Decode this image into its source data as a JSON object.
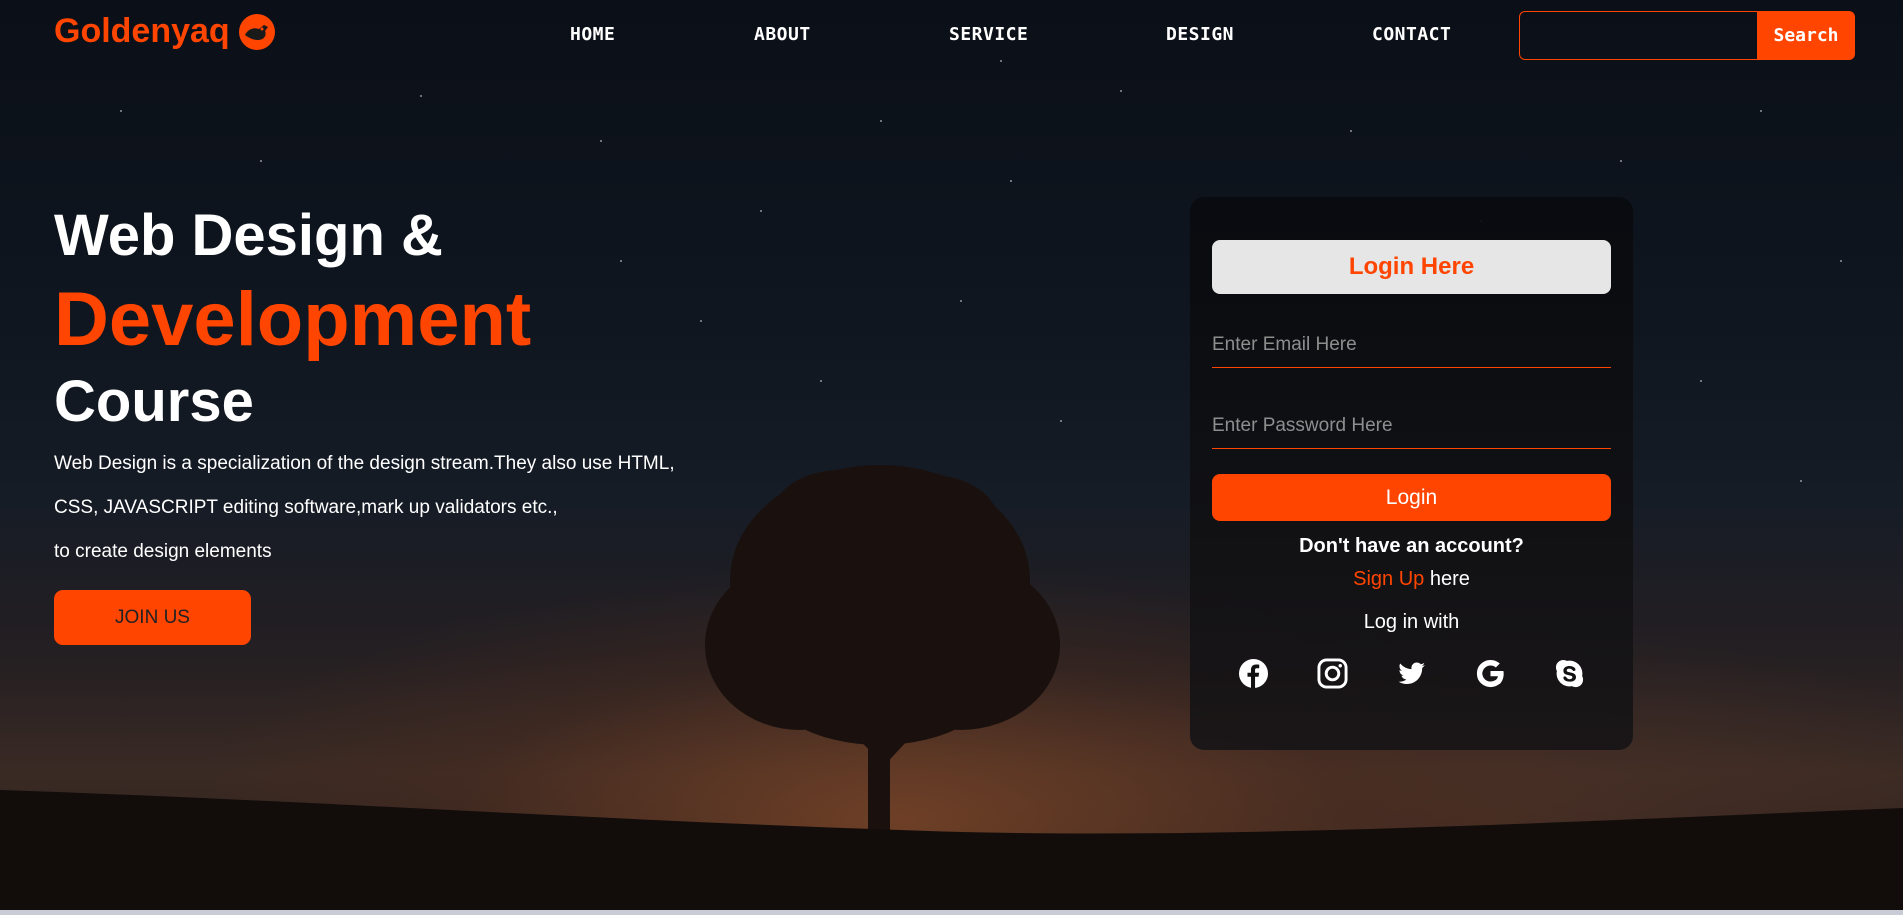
{
  "brand": {
    "name": "Goldenyaq",
    "icon": "brand-logo-icon"
  },
  "nav": {
    "links": [
      {
        "label": "HOME"
      },
      {
        "label": "ABOUT"
      },
      {
        "label": "SERVICE"
      },
      {
        "label": "DESIGN"
      },
      {
        "label": "CONTACT"
      }
    ],
    "search": {
      "value": "",
      "placeholder": "",
      "button_label": "Search"
    }
  },
  "hero": {
    "title_line1": "Web Design &",
    "title_line2": "Development",
    "title_line3": "Course",
    "description": [
      "Web Design is a specialization of the design stream.They also use HTML,",
      "CSS, JAVASCRIPT editing software,mark up validators etc.,",
      "to create design elements"
    ],
    "join_button": "JOIN US"
  },
  "login": {
    "title": "Login Here",
    "email_placeholder": "Enter Email Here",
    "password_placeholder": "Enter Password Here",
    "login_button": "Login",
    "no_account": "Don't have an account?",
    "signup_link": "Sign Up",
    "signup_suffix": " here",
    "login_with": "Log in with",
    "socials": [
      "facebook-icon",
      "instagram-icon",
      "twitter-icon",
      "google-icon",
      "skype-icon"
    ]
  },
  "colors": {
    "accent": "#ff4500",
    "text": "#ffffff",
    "card_bg": "#0b0d12",
    "title_button_bg": "#e6e6e6"
  }
}
